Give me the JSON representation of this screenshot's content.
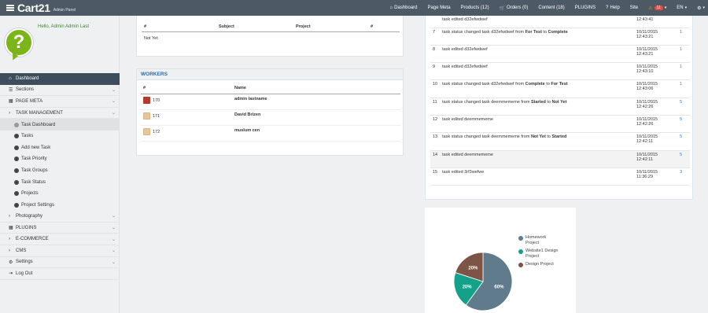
{
  "header": {
    "logo": "Cart21",
    "subtitle": "Admin Panel",
    "nav": [
      {
        "label": "Dashboard",
        "icon": "home-icon",
        "glyph": "⌂"
      },
      {
        "label": "Page Meta",
        "icon": "",
        "glyph": ""
      },
      {
        "label": "Products (12)",
        "icon": "",
        "glyph": ""
      },
      {
        "label": "Orders (0)",
        "icon": "cart-icon",
        "glyph": "🛒"
      },
      {
        "label": "Content (18)",
        "icon": "",
        "glyph": ""
      },
      {
        "label": "PLUGINS",
        "icon": "",
        "glyph": ""
      },
      {
        "label": "Help",
        "icon": "question-icon",
        "glyph": "?"
      },
      {
        "label": "Site",
        "icon": "",
        "glyph": ""
      }
    ],
    "alerts_count": "11",
    "language": "EN"
  },
  "sidebar": {
    "greeting": "Hello, Admin Admin Last",
    "items": [
      {
        "label": "Dashboard",
        "icon": "home-icon",
        "glyph": "⌂",
        "active": true,
        "chevron": false
      },
      {
        "label": "Sections",
        "icon": "list-icon",
        "glyph": "☰",
        "chevron": true
      },
      {
        "label": "PAGE META",
        "icon": "grid-icon",
        "glyph": "▦",
        "chevron": true
      },
      {
        "label": "TASK MANAGEMENT",
        "icon": "chevron-right-icon",
        "glyph": "›",
        "chevron": true
      },
      {
        "label": "Task Dashboard",
        "sub": true,
        "selected": true
      },
      {
        "label": "Tasks",
        "sub": true
      },
      {
        "label": "Add new Task",
        "sub": true
      },
      {
        "label": "Task Priority",
        "sub": true
      },
      {
        "label": "Task Groups",
        "sub": true
      },
      {
        "label": "Task Status",
        "sub": true
      },
      {
        "label": "Projects",
        "sub": true
      },
      {
        "label": "Project Settings",
        "sub": true
      },
      {
        "label": "Photography",
        "icon": "chevron-right-icon",
        "glyph": "›",
        "chevron": true
      },
      {
        "label": "PLUGINS",
        "icon": "grid-icon",
        "glyph": "▦",
        "chevron": true
      },
      {
        "label": "E-COMMERCE",
        "icon": "chevron-right-icon",
        "glyph": "›",
        "chevron": true
      },
      {
        "label": "CMS",
        "icon": "chevron-right-icon",
        "glyph": "›",
        "chevron": true
      },
      {
        "label": "Settings",
        "icon": "gear-icon",
        "glyph": "⚙",
        "chevron": true
      },
      {
        "label": "Log Out",
        "icon": "logout-icon",
        "glyph": "⇥",
        "chevron": false
      }
    ]
  },
  "tasks_table": {
    "headers": [
      "#",
      "Subject",
      "Project",
      "#"
    ],
    "empty_row": "Not Yet"
  },
  "workers": {
    "title": "WORKERS",
    "headers": [
      "#",
      "Name"
    ],
    "rows": [
      {
        "id": "170",
        "name": "admin lastname",
        "icon": "user-icon"
      },
      {
        "id": "171",
        "name": "David Brizen",
        "icon": "user-edit-icon"
      },
      {
        "id": "172",
        "name": "muslum cen",
        "icon": "user-edit-icon"
      }
    ]
  },
  "activity_log": [
    {
      "n": "",
      "text": [
        {
          "t": "task edited d32efwdwef"
        }
      ],
      "date": "12:43:41",
      "count": "",
      "first": true
    },
    {
      "n": "7",
      "text": [
        {
          "t": "task status changed task d32efwdwef from "
        },
        {
          "t": "For Test",
          "b": true
        },
        {
          "t": " to "
        },
        {
          "t": "Complete",
          "b": true
        }
      ],
      "date": "10/11/2015 12:43:21",
      "count": "1"
    },
    {
      "n": "8",
      "text": [
        {
          "t": "task edited d32efwdwef"
        }
      ],
      "date": "10/11/2015 12:43:21",
      "count": "1"
    },
    {
      "n": "9",
      "text": [
        {
          "t": "task edited d32efwdwef"
        }
      ],
      "date": "10/11/2015 12:43:10",
      "count": "1"
    },
    {
      "n": "10",
      "text": [
        {
          "t": "task status changed task d32efwdwef from "
        },
        {
          "t": "Complete",
          "b": true
        },
        {
          "t": " to "
        },
        {
          "t": "For Test",
          "b": true
        }
      ],
      "date": "10/11/2015 12:43:06",
      "count": "1"
    },
    {
      "n": "11",
      "text": [
        {
          "t": "task status changed task deemmememe from "
        },
        {
          "t": "Started",
          "b": true
        },
        {
          "t": " to "
        },
        {
          "t": "Not Yet",
          "b": true
        }
      ],
      "date": "10/11/2015 12:42:26",
      "count": "5"
    },
    {
      "n": "12",
      "text": [
        {
          "t": "task edited deemmememe"
        }
      ],
      "date": "10/11/2015 12:42:26",
      "count": "5"
    },
    {
      "n": "13",
      "text": [
        {
          "t": "task status changed task deemmememe from "
        },
        {
          "t": "Not Yet",
          "b": true
        },
        {
          "t": " to "
        },
        {
          "t": "Started",
          "b": true
        }
      ],
      "date": "10/11/2015 12:42:11",
      "count": "5"
    },
    {
      "n": "14",
      "text": [
        {
          "t": "task edited deemmememe"
        }
      ],
      "date": "10/11/2015 12:42:11",
      "count": "5",
      "highlight": true
    },
    {
      "n": "15",
      "text": [
        {
          "t": "task edited 3rf3wefwe"
        }
      ],
      "date": "10/11/2015 11:36:29",
      "count": "3"
    }
  ],
  "chart_data": {
    "type": "pie",
    "series": [
      {
        "name": "Homework Project",
        "value": 60,
        "label": "60%",
        "color": "#5f7b8c"
      },
      {
        "name": "Website1 Design Project",
        "value": 20,
        "label": "20%",
        "color": "#15a08a"
      },
      {
        "name": "Design Project",
        "value": 20,
        "label": "20%",
        "color": "#7d5546"
      }
    ]
  }
}
